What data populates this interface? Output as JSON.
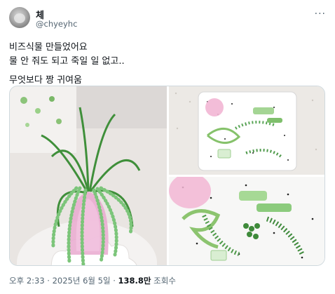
{
  "author": {
    "display_name": "체",
    "handle": "@chyeyhc",
    "avatar_icon": "avatar-image",
    "more_icon": "more-options-icon"
  },
  "post": {
    "lines": [
      "비즈식물 만들었어요",
      "물 안 줘도 되고 죽일 일 없고..",
      "무엇보다 짱 귀여움"
    ]
  },
  "media": {
    "photos": [
      {
        "label": "beaded-plant-in-pink-pot"
      },
      {
        "label": "bead-parts-on-tray"
      },
      {
        "label": "bead-parts-closeup"
      }
    ]
  },
  "meta": {
    "timestamp": "오후 2:33 · 2025년 6월 5일",
    "separator": " · ",
    "views_count": "138.8만",
    "views_label": " 조회수"
  },
  "colors": {
    "accent_text": "#0f1419",
    "secondary_text": "#536471",
    "border": "#cfd9de"
  }
}
